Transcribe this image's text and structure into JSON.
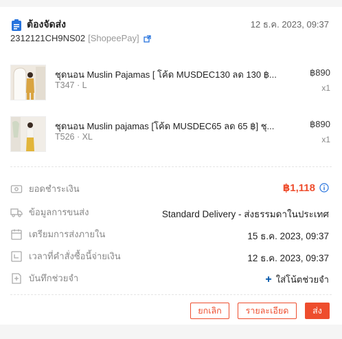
{
  "header": {
    "status": "ต้องจัดส่ง",
    "date": "12 ธ.ค. 2023, 09:37",
    "order_id": "2312121CH9NS02",
    "payment": "[ShopeePay]"
  },
  "items": [
    {
      "name": "ชุดนอน Muslin Pajamas [ โค้ด MUSDEC130 ลด 130 ฿...",
      "variant": "T347 · L",
      "price": "฿890",
      "qty": "x1"
    },
    {
      "name": "ชุดนอน Muslin pajamas [โค้ด MUSDEC65 ลด 65 ฿] ชุ...",
      "variant": "T526 · XL",
      "price": "฿890",
      "qty": "x1"
    }
  ],
  "details": {
    "total_label": "ยอดชำระเงิน",
    "total_value": "฿1,118",
    "shipping_label": "ข้อมูลการขนส่ง",
    "shipping_value": "Standard Delivery - ส่งธรรมดาในประเทศ",
    "prepare_label": "เตรียมการส่งภายใน",
    "prepare_value": "15 ธ.ค. 2023, 09:37",
    "paid_label": "เวลาที่คำสั่งซื้อนี้จ่ายเงิน",
    "paid_value": "12 ธ.ค. 2023, 09:37",
    "note_label": "บันทึกช่วยจำ",
    "note_action": "ใส่โน้ตช่วยจำ"
  },
  "actions": {
    "cancel": "ยกเลิก",
    "details": "รายละเอียด",
    "ship": "ส่ง"
  },
  "colors": {
    "accent": "#ee4d2d",
    "link": "#0055aa",
    "status_icon": "#2673dd"
  }
}
